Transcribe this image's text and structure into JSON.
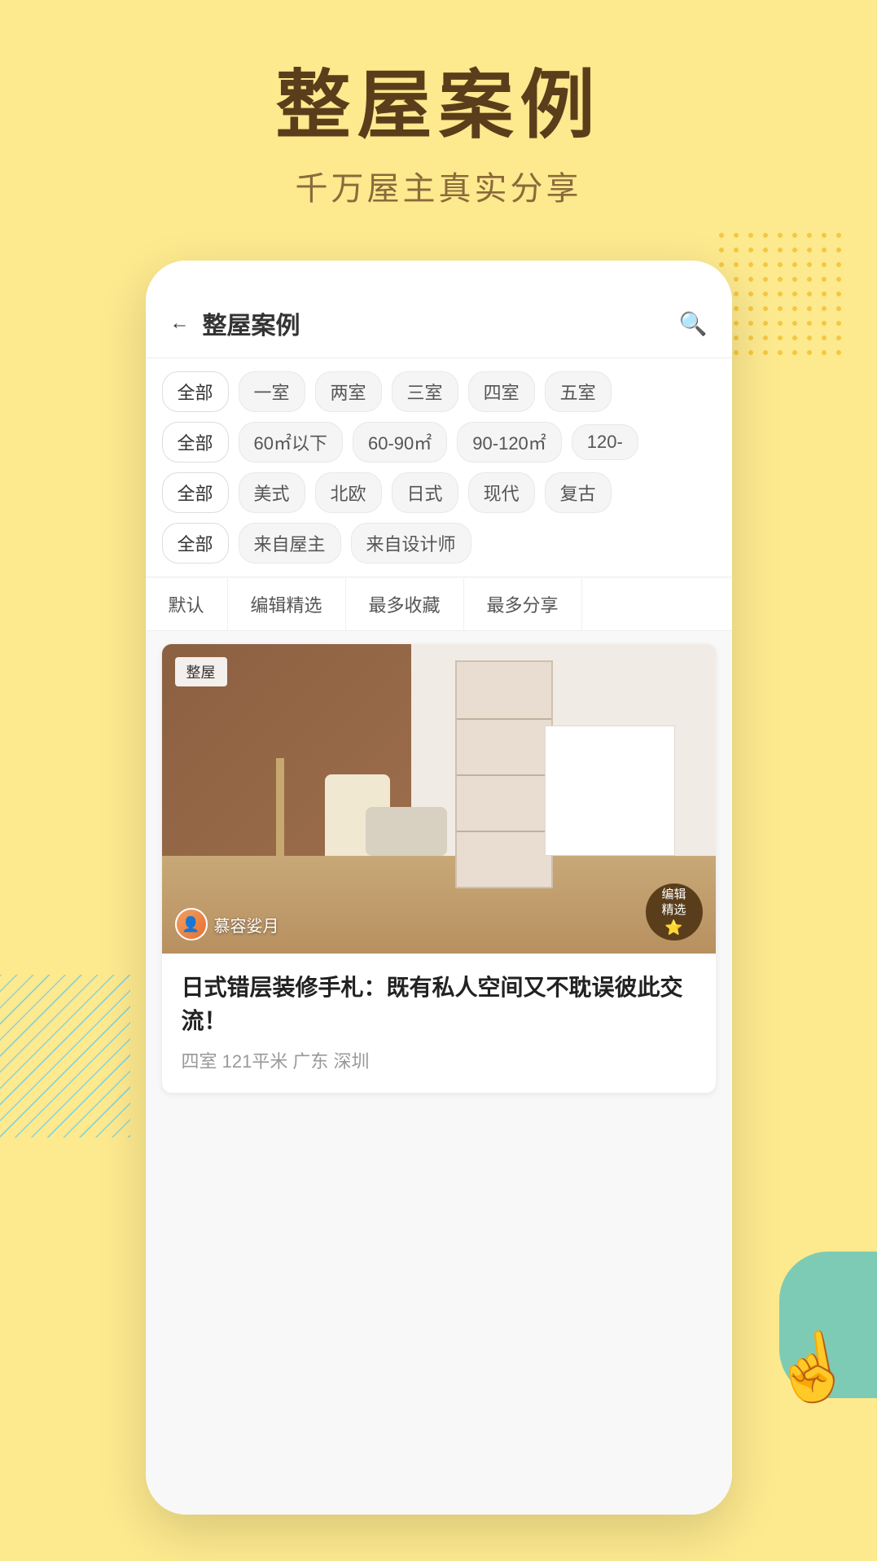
{
  "page": {
    "background_color": "#fde98e",
    "main_title": "整屋案例",
    "sub_title": "千万屋主真实分享"
  },
  "header": {
    "back_label": "←",
    "title": "整屋案例",
    "search_icon": "🔍"
  },
  "filters": {
    "row1": {
      "tags": [
        "全部",
        "一室",
        "两室",
        "三室",
        "四室",
        "五室"
      ],
      "active_index": 0
    },
    "row2": {
      "tags": [
        "全部",
        "60㎡以下",
        "60-90㎡",
        "90-120㎡",
        "120-"
      ],
      "active_index": 0
    },
    "row3": {
      "tags": [
        "全部",
        "美式",
        "北欧",
        "日式",
        "现代",
        "复古"
      ],
      "active_index": 0
    },
    "row4": {
      "tags": [
        "全部",
        "来自屋主",
        "来自设计师"
      ],
      "active_index": 0
    }
  },
  "sort": {
    "options": [
      "默认",
      "编辑精选",
      "最多收藏",
      "最多分享"
    ]
  },
  "card": {
    "badge": "整屋",
    "editor_badge_line1": "编辑",
    "editor_badge_line2": "精选",
    "author_name": "慕容娑月",
    "title": "日式错层装修手札：既有私人空间又不耽误彼此交流！",
    "meta": "四室  121平米  广东 深圳"
  },
  "icons": {
    "back": "←",
    "search": "⌕",
    "star": "★"
  }
}
